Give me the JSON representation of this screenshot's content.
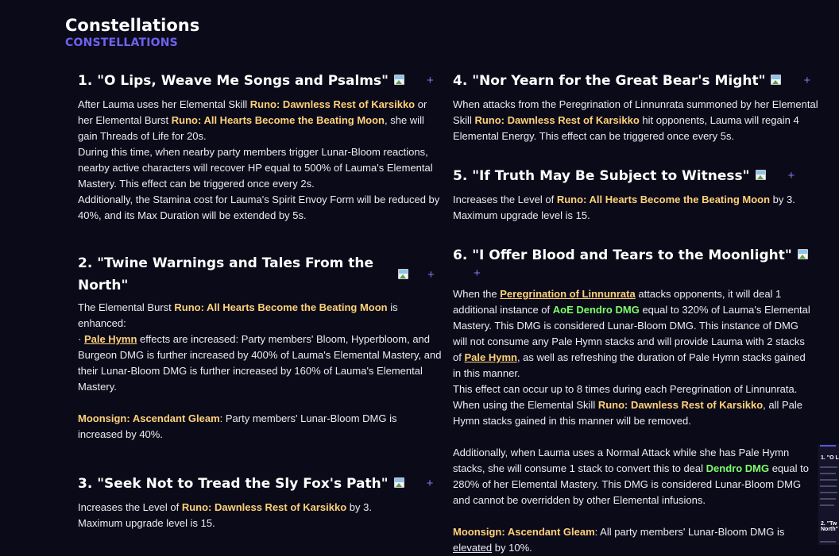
{
  "page": {
    "title": "Constellations",
    "subtitle": "CONSTELLATIONS"
  },
  "icons": {
    "plus": "+",
    "image_placeholder": "broken-image-icon"
  },
  "colors": {
    "background": "#0b0a18",
    "accent": "#6e62f0",
    "highlight": "#ffd27a",
    "dendro": "#7dff6a"
  },
  "constellations": [
    {
      "title": "1. \"O Lips, Weave Me Songs and Psalms\"",
      "p1": [
        "After Lauma uses her Elemental Skill ",
        "Runo: Dawnless Rest of Karsikko",
        " or her Elemental Burst ",
        "Runo: All Hearts Become the Beating Moon",
        ", she will gain Threads of Life for 20s."
      ],
      "p2": "During this time, when nearby party members trigger Lunar-Bloom reactions, nearby active characters will recover HP equal to 500% of Lauma's Elemental Mastery. This effect can be triggered once every 2s.",
      "p3": "Additionally, the Stamina cost for Lauma's Spirit Envoy Form will be reduced by 40%, and its Max Duration will be extended by 5s."
    },
    {
      "title_line1": "2. \"Twine Warnings and Tales From the",
      "title_line2": "North\"",
      "p1": [
        "The Elemental Burst ",
        "Runo: All Hearts Become the Beating Moon",
        " is enhanced:"
      ],
      "p2": [
        "· ",
        "Pale Hymn",
        " effects are increased: Party members' Bloom, Hyperbloom, and Burgeon DMG is further increased by 400% of Lauma's Elemental Mastery, and their Lunar-Bloom DMG is further increased by 160% of Lauma's Elemental Mastery."
      ],
      "p3": [
        "Moonsign: Ascendant Gleam",
        ": Party members' Lunar-Bloom DMG is increased by 40%."
      ]
    },
    {
      "title": "3. \"Seek Not to Tread the Sly Fox's Path\"",
      "p1": [
        "Increases the Level of ",
        "Runo: Dawnless Rest of Karsikko",
        " by 3."
      ],
      "p2": "Maximum upgrade level is 15."
    },
    {
      "title": "4. \"Nor Yearn for the Great Bear's Might\"",
      "p1": [
        "When attacks from the Peregrination of Linnunrata summoned by her Elemental Skill ",
        "Runo: Dawnless Rest of Karsikko",
        " hit opponents, Lauma will regain 4 Elemental Energy. This effect can be triggered once every 5s."
      ]
    },
    {
      "title": "5. \"If Truth May Be Subject to Witness\"",
      "p1": [
        "Increases the Level of ",
        "Runo: All Hearts Become the Beating Moon",
        " by 3."
      ],
      "p2": "Maximum upgrade level is 15."
    },
    {
      "title": "6. \"I Offer Blood and Tears to the Moonlight\"",
      "p1": [
        "When the ",
        "Peregrination of Linnunrata",
        " attacks opponents, it will deal 1 additional instance of ",
        "AoE Dendro DMG",
        " equal to 320% of Lauma's Elemental Mastery. This DMG is considered Lunar-Bloom DMG. This instance of DMG will not consume any Pale Hymn stacks and will provide Lauma with 2 stacks of ",
        "Pale Hymn",
        ", as well as refreshing the duration of Pale Hymn stacks gained in this manner."
      ],
      "p2": [
        "This effect can occur up to 8 times during each Peregrination of Linnunrata. When using the Elemental Skill ",
        "Runo: Dawnless Rest of Karsikko",
        ", all Pale Hymn stacks gained in this manner will be removed."
      ],
      "p3": [
        "Additionally, when Lauma uses a Normal Attack while she has Pale Hymn stacks, she will consume 1 stack to convert this to deal ",
        "Dendro DMG",
        " equal to 280% of her Elemental Mastery. This DMG is considered Lunar-Bloom DMG and cannot be overridden by other Elemental infusions."
      ],
      "p4": [
        "Moonsign: Ascendant Gleam",
        ": All party members' Lunar-Bloom DMG is ",
        "elevated",
        " by 10%."
      ]
    }
  ],
  "sidebar_preview": {
    "item1": "1. \"O L",
    "item2": "2. \"Tw",
    "item2b": "North\""
  }
}
